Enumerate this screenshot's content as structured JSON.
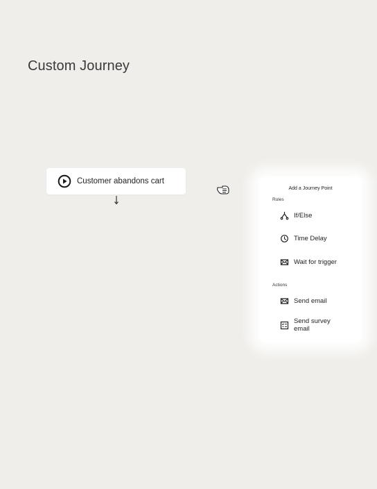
{
  "page": {
    "title": "Custom Journey"
  },
  "trigger": {
    "label": "Customer abandons cart",
    "icon": "play-circle-icon"
  },
  "menu": {
    "title": "Add a Journey Point",
    "sections": [
      {
        "label": "Rules",
        "items": [
          {
            "label": "If/Else",
            "icon": "branch-icon"
          },
          {
            "label": "Time Delay",
            "icon": "clock-icon"
          },
          {
            "label": "Wait for trigger",
            "icon": "envelope-icon"
          }
        ]
      },
      {
        "label": "Actions",
        "items": [
          {
            "label": "Send email",
            "icon": "envelope-icon"
          },
          {
            "label": "Send survey email",
            "icon": "survey-icon"
          }
        ]
      }
    ]
  }
}
